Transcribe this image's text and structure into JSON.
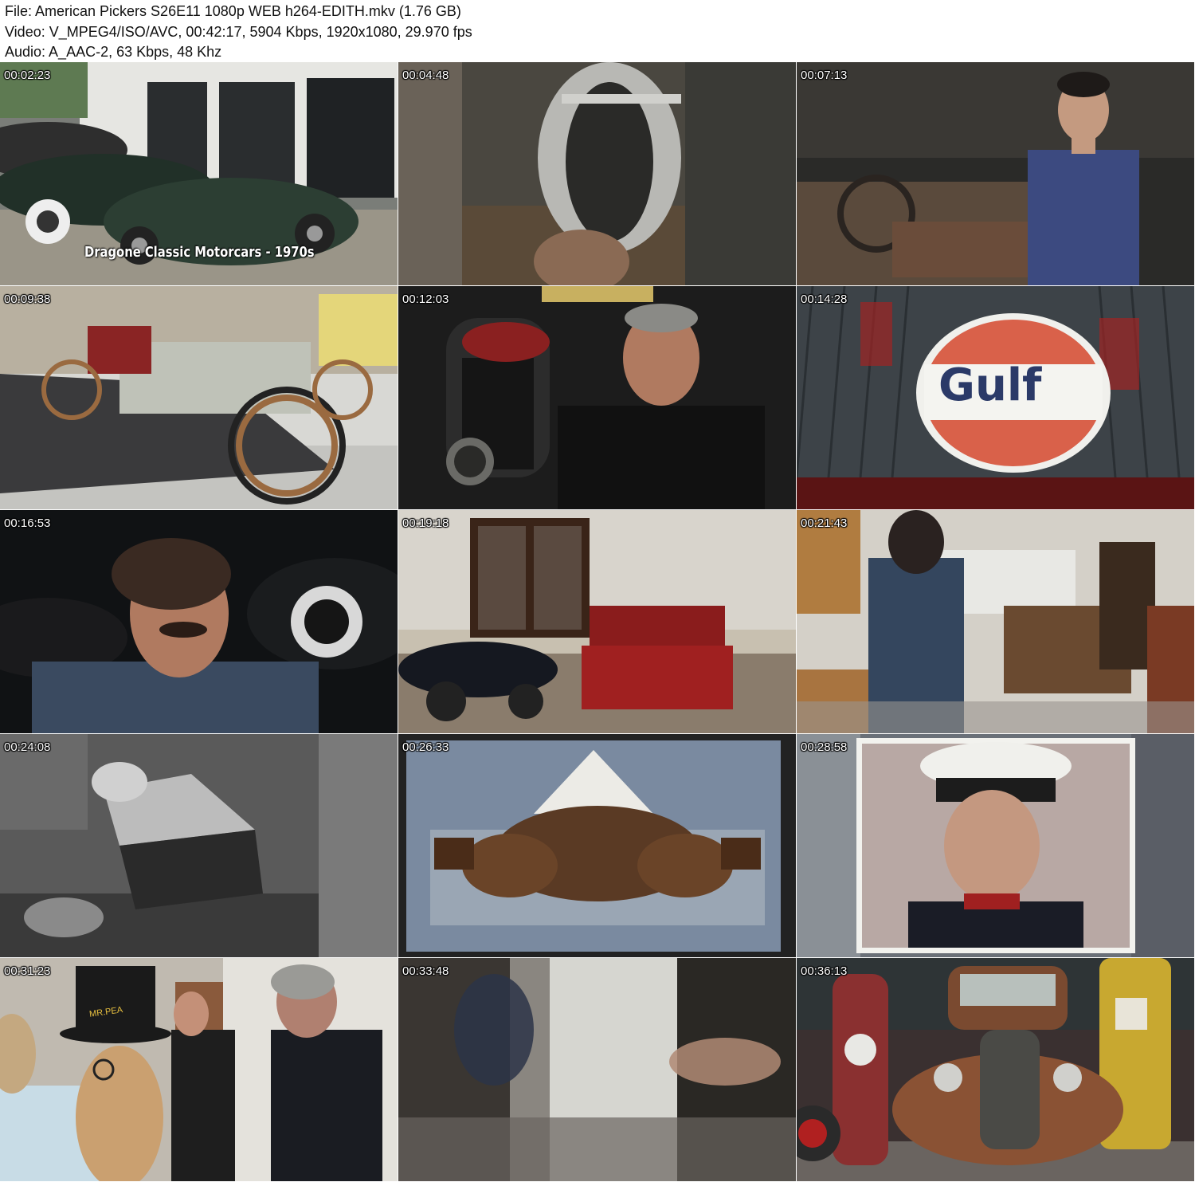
{
  "header": {
    "file_line": "File: American Pickers S26E11 1080p WEB h264-EDITH.mkv (1.76 GB)",
    "video_line": "Video: V_MPEG4/ISO/AVC, 00:42:17, 5904 Kbps, 1920x1080, 29.970 fps",
    "audio_line": "Audio: A_AAC-2, 63 Kbps, 48 Khz"
  },
  "thumbnails": [
    {
      "timestamp": "00:02:23",
      "caption": "Dragone Classic Motorcars - 1970s"
    },
    {
      "timestamp": "00:04:48"
    },
    {
      "timestamp": "00:07:13"
    },
    {
      "timestamp": "00:09:38"
    },
    {
      "timestamp": "00:12:03"
    },
    {
      "timestamp": "00:14:28",
      "sign_text": "Gulf"
    },
    {
      "timestamp": "00:16:53"
    },
    {
      "timestamp": "00:19:18"
    },
    {
      "timestamp": "00:21:43"
    },
    {
      "timestamp": "00:24:08"
    },
    {
      "timestamp": "00:26:33"
    },
    {
      "timestamp": "00:28:58"
    },
    {
      "timestamp": "00:31:23",
      "hat_text": "MR.PEA"
    },
    {
      "timestamp": "00:33:48"
    },
    {
      "timestamp": "00:36:13"
    }
  ],
  "colors": {
    "background": "#ffffff",
    "text": "#111111",
    "timestamp": "#ffffff",
    "gulf_orange": "#d9614a",
    "gulf_blue": "#2b3a68"
  }
}
